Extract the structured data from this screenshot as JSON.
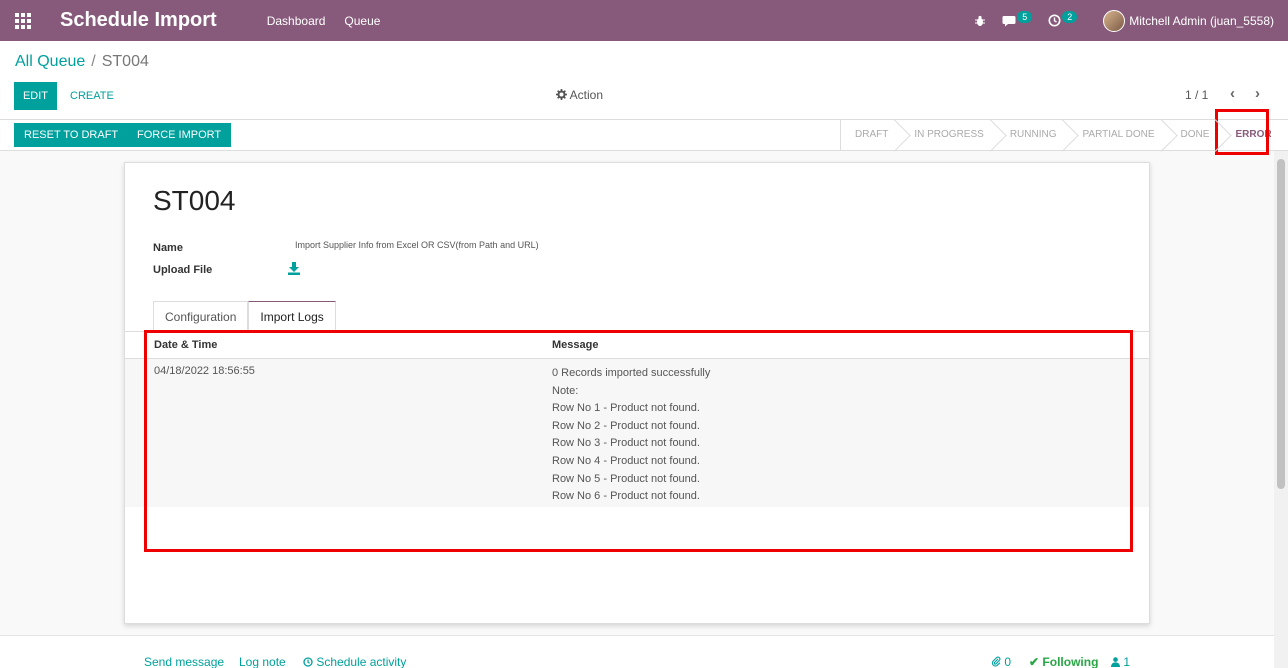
{
  "navbar": {
    "app_title": "Schedule Import",
    "menu": [
      "Dashboard",
      "Queue"
    ],
    "messages_count": "5",
    "activities_count": "2",
    "user_name": "Mitchell Admin (juan_5558)"
  },
  "breadcrumb": {
    "parent": "All Queue",
    "separator": "/",
    "current": "ST004"
  },
  "toolbar": {
    "edit_label": "EDIT",
    "create_label": "CREATE",
    "action_label": "Action",
    "pager": "1 / 1"
  },
  "statusbar": {
    "reset_label": "RESET TO DRAFT",
    "force_label": "FORCE IMPORT",
    "stages": [
      "DRAFT",
      "IN PROGRESS",
      "RUNNING",
      "PARTIAL DONE",
      "DONE",
      "ERROR"
    ],
    "active_stage": "ERROR"
  },
  "form": {
    "title": "ST004",
    "name_label": "Name",
    "name_value": "Import Supplier Info from Excel OR CSV(from Path and URL)",
    "upload_label": "Upload File",
    "tabs": [
      "Configuration",
      "Import Logs"
    ],
    "active_tab": "Import Logs",
    "logs": {
      "headers": [
        "Date & Time",
        "Message"
      ],
      "rows": [
        {
          "date": "04/18/2022 18:56:55",
          "message": "0 Records imported successfully\nNote:\nRow No 1  - Product not found.\nRow No 2  - Product not found.\nRow No 3  - Product not found.\nRow No 4  - Product not found.\nRow No 5  - Product not found.\nRow No 6  - Product not found."
        }
      ]
    }
  },
  "chatter": {
    "send_message": "Send message",
    "log_note": "Log note",
    "schedule_activity": "Schedule activity",
    "attachments": "0",
    "following": "Following",
    "followers": "1"
  },
  "colors": {
    "brand": "#875a7b",
    "accent": "#00a09d",
    "highlight": "#e00000"
  }
}
